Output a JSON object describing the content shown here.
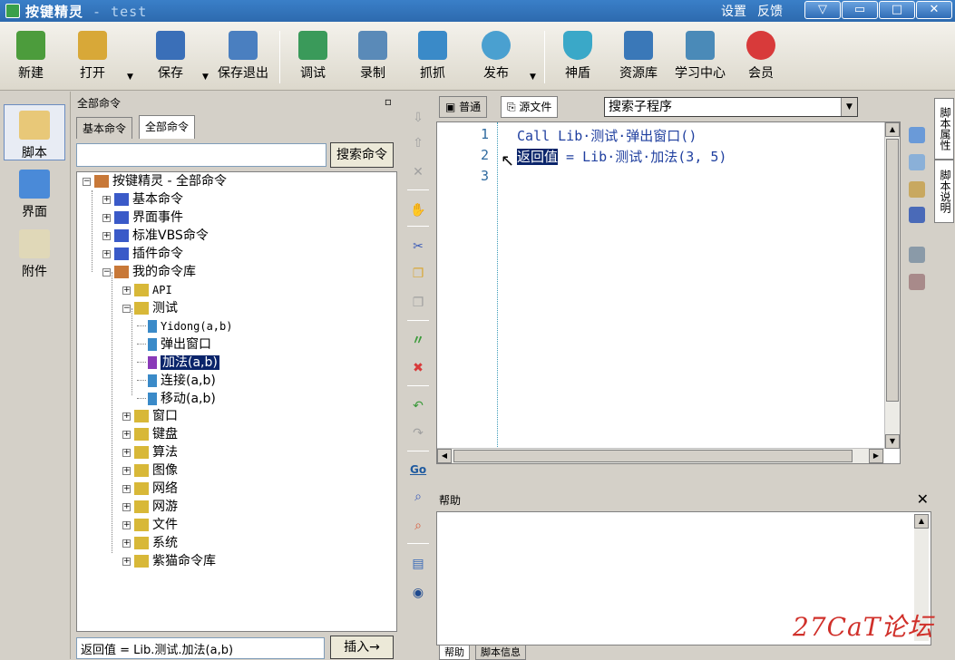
{
  "window": {
    "app_name": "按键精灵",
    "separator": " - ",
    "doc_name": "test",
    "links": [
      "设置",
      "反馈"
    ],
    "controls": [
      "▽",
      "▭",
      "□",
      "✕"
    ]
  },
  "toolbar": {
    "items": [
      {
        "label": "新建",
        "icon": "new-file-icon",
        "color": "#4c9c3c"
      },
      {
        "label": "打开",
        "icon": "open-folder-icon",
        "color": "#d8a838"
      },
      {
        "label": "保存",
        "icon": "save-disk-icon",
        "color": "#3a6fb8"
      },
      {
        "label": "保存退出",
        "icon": "save-exit-icon",
        "color": "#4a7fc0"
      },
      {
        "label": "调试",
        "icon": "debug-icon",
        "color": "#3a9a5a"
      },
      {
        "label": "录制",
        "icon": "record-camera-icon",
        "color": "#5a8ab8"
      },
      {
        "label": "抓抓",
        "icon": "grab-icon",
        "color": "#3a8ac8"
      },
      {
        "label": "发布",
        "icon": "publish-globe-icon",
        "color": "#4aa0d0"
      },
      {
        "label": "神盾",
        "icon": "shield-icon",
        "color": "#3aa8c8"
      },
      {
        "label": "资源库",
        "icon": "resource-icon",
        "color": "#3a78b8"
      },
      {
        "label": "学习中心",
        "icon": "learning-center-icon",
        "color": "#4a8ab8"
      },
      {
        "label": "会员",
        "icon": "member-icon",
        "color": "#d83a3a"
      }
    ],
    "dropdown_arrow": "▼"
  },
  "leftnav": {
    "items": [
      {
        "label": "脚本",
        "color": "#e8c878"
      },
      {
        "label": "界面",
        "color": "#4a8ad8"
      },
      {
        "label": "附件",
        "color": "#e0d8b8"
      }
    ]
  },
  "cmd_panel": {
    "title": "全部命令",
    "pin": "▫",
    "tabs": [
      "基本命令",
      "全部命令"
    ],
    "search_value": "",
    "search_button": "搜索命令",
    "insert_value": "返回值 = Lib.测试.加法(a,b)",
    "insert_button": "插入→",
    "tree": {
      "root": "按键精灵 - 全部命令",
      "level1": [
        "基本命令",
        "界面事件",
        "标准VBS命令",
        "插件命令",
        "我的命令库"
      ],
      "mylib_children_top": [
        "API",
        "测试"
      ],
      "test_children": [
        "Yidong(a,b)",
        "弹出窗口",
        "加法(a,b)",
        "连接(a,b)",
        "移动(a,b)"
      ],
      "mylib_children_rest": [
        "窗口",
        "键盘",
        "算法",
        "图像",
        "网络",
        "网游",
        "文件",
        "系统",
        "紫猫命令库"
      ]
    }
  },
  "vstrip": {
    "icons": [
      "⇩",
      "⇧",
      "✕",
      "✋",
      "✂",
      "❐",
      "❐",
      "〃",
      "✖",
      "↶",
      "↷",
      "Go",
      "⌕",
      "⌕",
      "▤",
      "◉"
    ]
  },
  "editor": {
    "tabs": [
      "普通",
      "源文件"
    ],
    "dropdown_value": "搜索子程序",
    "line_numbers": [
      "1",
      "2",
      "3"
    ],
    "line1": "Call Lib·测试·弹出窗口()",
    "line2_selected": "返回值",
    "line2_rest": " = Lib·测试·加法(3, 5)",
    "line3": "",
    "cursor": "↖",
    "side_tabs": [
      "脚本属性",
      "脚本说明"
    ]
  },
  "help": {
    "title": "帮助",
    "close": "✕",
    "tabs": [
      "帮助",
      "脚本信息"
    ]
  },
  "watermark": "27CaT论坛"
}
